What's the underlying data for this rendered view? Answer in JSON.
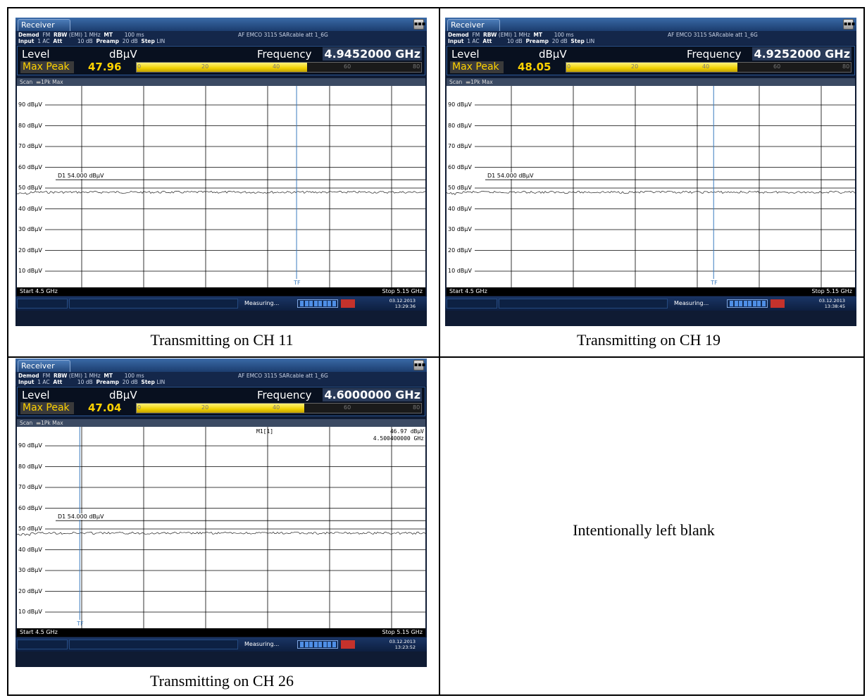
{
  "panels": [
    {
      "id": "ch11",
      "caption": "Transmitting on CH 11",
      "tab_label": "Receiver",
      "info_line1": {
        "demod_key": "Demod",
        "demod_val": "FM",
        "rbw_key": "RBW",
        "rbw_val": "(EMI) 1 MHz",
        "mt_key": "MT",
        "mt_val": "100 ms",
        "transducer": "AF EMCO 3115 SARcable att 1_6G"
      },
      "info_line2": {
        "input_key": "Input",
        "input_val": "1 AC",
        "att_key": "Att",
        "att_val": "10 dB",
        "preamp_key": "Preamp",
        "preamp_val": "20 dB",
        "step_key": "Step",
        "step_val": "LIN"
      },
      "level_label": "Level",
      "level_unit": "dBμV",
      "frequency_label": "Frequency",
      "frequency": "4.9452000 GHz",
      "detector": "Max Peak",
      "level_value": "47.96",
      "level_fraction": 0.5995,
      "bar_ticks": [
        "0",
        "20",
        "40",
        "60",
        "80"
      ],
      "scan_label": "Scan",
      "trace_label": "1Pk Max",
      "y_labels": [
        "90 dBμV",
        "80 dBμV",
        "70 dBμV",
        "60 dBμV",
        "50 dBμV",
        "40 dBμV",
        "30 dBμV",
        "20 dBμV",
        "10 dBμV"
      ],
      "limit_line_label": "D1 54.000 dBμV",
      "tf_label": "TF",
      "tf_freq_ghz": 4.945,
      "start_label": "Start 4.5 GHz",
      "stop_label": "Stop 5.15 GHz",
      "status_measuring": "Measuring...",
      "date": "03.12.2013",
      "time": "13:29:36",
      "marker": null
    },
    {
      "id": "ch19",
      "caption": "Transmitting on CH 19",
      "tab_label": "Receiver",
      "info_line1": {
        "demod_key": "Demod",
        "demod_val": "FM",
        "rbw_key": "RBW",
        "rbw_val": "(EMI) 1 MHz",
        "mt_key": "MT",
        "mt_val": "100 ms",
        "transducer": "AF EMCO 3115 SARcable att 1_6G"
      },
      "info_line2": {
        "input_key": "Input",
        "input_val": "1 AC",
        "att_key": "Att",
        "att_val": "10 dB",
        "preamp_key": "Preamp",
        "preamp_val": "20 dB",
        "step_key": "Step",
        "step_val": "LIN"
      },
      "level_label": "Level",
      "level_unit": "dBμV",
      "frequency_label": "Frequency",
      "frequency": "4.9252000 GHz",
      "detector": "Max Peak",
      "level_value": "48.05",
      "level_fraction": 0.6006,
      "bar_ticks": [
        "0",
        "20",
        "40",
        "60",
        "80"
      ],
      "scan_label": "Scan",
      "trace_label": "1Pk Max",
      "y_labels": [
        "90 dBμV",
        "80 dBμV",
        "70 dBμV",
        "60 dBμV",
        "50 dBμV",
        "40 dBμV",
        "30 dBμV",
        "20 dBμV",
        "10 dBμV"
      ],
      "limit_line_label": "D1 54.000 dBμV",
      "tf_label": "TF",
      "tf_freq_ghz": 4.925,
      "start_label": "Start 4.5 GHz",
      "stop_label": "Stop 5.15 GHz",
      "status_measuring": "Measuring...",
      "date": "03.12.2013",
      "time": "13:38:45",
      "marker": null
    },
    {
      "id": "ch26",
      "caption": "Transmitting on CH 26",
      "tab_label": "Receiver",
      "info_line1": {
        "demod_key": "Demod",
        "demod_val": "FM",
        "rbw_key": "RBW",
        "rbw_val": "(EMI) 1 MHz",
        "mt_key": "MT",
        "mt_val": "100 ms",
        "transducer": "AF EMCO 3115 SARcable att 1_6G"
      },
      "info_line2": {
        "input_key": "Input",
        "input_val": "1 AC",
        "att_key": "Att",
        "att_val": "10 dB",
        "preamp_key": "Preamp",
        "preamp_val": "20 dB",
        "step_key": "Step",
        "step_val": "LIN"
      },
      "level_label": "Level",
      "level_unit": "dBμV",
      "frequency_label": "Frequency",
      "frequency": "4.6000000 GHz",
      "detector": "Max Peak",
      "level_value": "47.04",
      "level_fraction": 0.588,
      "bar_ticks": [
        "0",
        "20",
        "40",
        "60",
        "80"
      ],
      "scan_label": "Scan",
      "trace_label": "1Pk Max",
      "y_labels": [
        "90 dBμV",
        "80 dBμV",
        "70 dBμV",
        "60 dBμV",
        "50 dBμV",
        "40 dBμV",
        "30 dBμV",
        "20 dBμV",
        "10 dBμV"
      ],
      "limit_line_label": "D1 54.000 dBμV",
      "tf_label": "TF",
      "tf_freq_ghz": 4.6,
      "start_label": "Start 4.5 GHz",
      "stop_label": "Stop 5.15 GHz",
      "status_measuring": "Measuring...",
      "date": "03.12.2013",
      "time": "13:23:52",
      "marker": {
        "name": "M1[1]",
        "level": "46.97 dBμV",
        "freq": "4.500400000 GHz"
      }
    }
  ],
  "blank_text": "Intentionally left blank",
  "chart_data": [
    {
      "type": "line",
      "title": "",
      "xlabel": "",
      "ylabel": "",
      "x_range_ghz": [
        4.5,
        5.15
      ],
      "ylim": [
        0,
        100
      ],
      "y_ticks": [
        10,
        20,
        30,
        40,
        50,
        60,
        70,
        80,
        90
      ],
      "limit_line_dbuv": 54.0,
      "noise_floor_dbuv": 48.0,
      "tf_ghz": 4.945
    },
    {
      "type": "line",
      "title": "",
      "xlabel": "",
      "ylabel": "",
      "x_range_ghz": [
        4.5,
        5.15
      ],
      "ylim": [
        0,
        100
      ],
      "y_ticks": [
        10,
        20,
        30,
        40,
        50,
        60,
        70,
        80,
        90
      ],
      "limit_line_dbuv": 54.0,
      "noise_floor_dbuv": 48.0,
      "tf_ghz": 4.925
    },
    {
      "type": "line",
      "title": "",
      "xlabel": "",
      "ylabel": "",
      "x_range_ghz": [
        4.5,
        5.15
      ],
      "ylim": [
        0,
        100
      ],
      "y_ticks": [
        10,
        20,
        30,
        40,
        50,
        60,
        70,
        80,
        90
      ],
      "limit_line_dbuv": 54.0,
      "noise_floor_dbuv": 48.0,
      "tf_ghz": 4.6
    }
  ],
  "colors": {
    "accent": "#ffd200",
    "frame": "#0f1b33",
    "tf_line": "#3a7bbf"
  }
}
